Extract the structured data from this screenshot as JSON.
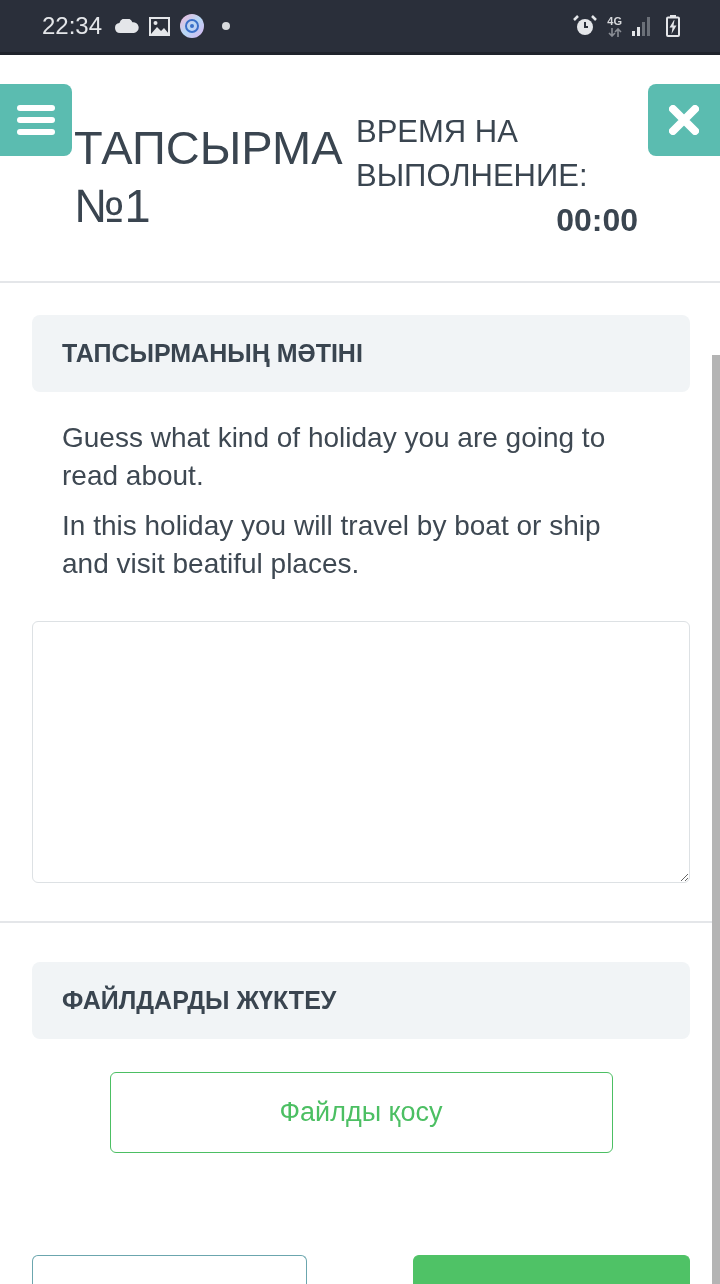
{
  "status_bar": {
    "time": "22:34",
    "network": "4G"
  },
  "header": {
    "title": "ТАПСЫРМА №1",
    "timer_label": "ВРЕМЯ НА ВЫПОЛНЕНИЕ:",
    "timer_value": "00:00"
  },
  "task_section": {
    "heading": "ТАПСЫРМАНЫҢ МӘТІНІ",
    "paragraphs": [
      "Guess what kind of holiday you are going to read about.",
      "In this holiday you will travel by boat or ship and visit beatiful places."
    ]
  },
  "upload_section": {
    "heading": "ФАЙЛДАРДЫ ЖҮКТЕУ",
    "button": "Файлды қосу"
  },
  "footer_buttons": [
    {
      "kind": "outline"
    },
    {
      "kind": "filled"
    }
  ]
}
